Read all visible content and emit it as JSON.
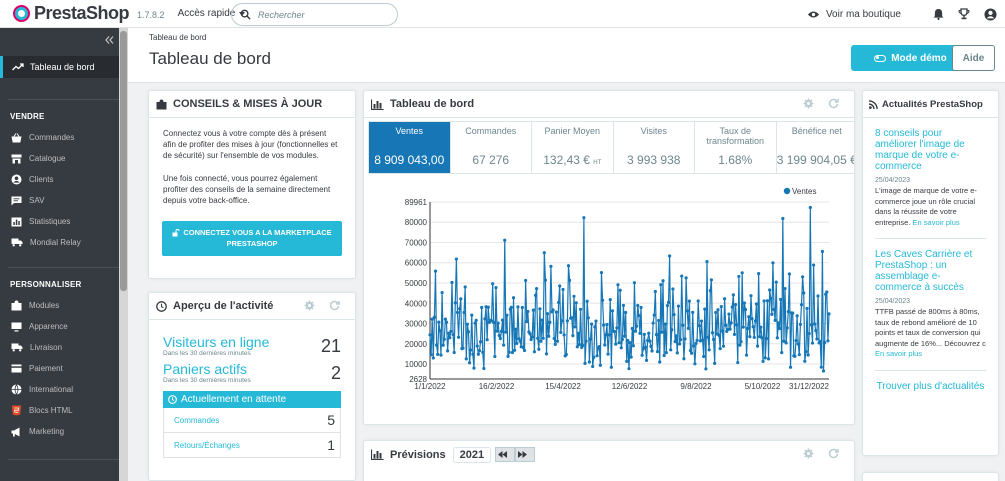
{
  "app": {
    "brand": "PrestaShop",
    "version": "1.7.8.2"
  },
  "topbar": {
    "quick_access": "Accès rapide",
    "search_placeholder": "Rechercher",
    "view_shop": "Voir ma boutique"
  },
  "sidebar": {
    "active_item": "Tableau de bord",
    "sections": [
      {
        "title": "VENDRE",
        "items": [
          "Commandes",
          "Catalogue",
          "Clients",
          "SAV",
          "Statistiques",
          "Mondial Relay"
        ]
      },
      {
        "title": "PERSONNALISER",
        "items": [
          "Modules",
          "Apparence",
          "Livraison",
          "Paiement",
          "International",
          "Blocs HTML",
          "Marketing"
        ]
      }
    ]
  },
  "header": {
    "breadcrumb": "Tableau de bord",
    "title": "Tableau de bord",
    "demo_button": "Mode démo",
    "help_button": "Aide"
  },
  "tips": {
    "title": "CONSEILS & MISES À JOUR",
    "p1": "Connectez vous à votre compte dès à présent afin de profiter des mises à jour (fonctionnelles et de sécurité) sur l'ensemble de vos modules.",
    "p2": "Une fois connecté, vous pourrez également profiter des conseils de la semaine directement depuis votre back-office.",
    "button_line1": "CONNECTEZ VOUS A LA MARKETPLACE",
    "button_line2": "PRESTASHOP"
  },
  "activity": {
    "title": "Aperçu de l'activité",
    "visitors_label": "Visiteurs en ligne",
    "visitors_sub": "Dans les 30 dernières minutes",
    "visitors_value": "21",
    "carts_label": "Paniers actifs",
    "carts_sub": "Dans les 30 dernières minutes",
    "carts_value": "2",
    "pending_title": "Actuellement en attente",
    "pending": [
      {
        "label": "Commandes",
        "value": "5"
      },
      {
        "label": "Retours/Échanges",
        "value": "1"
      }
    ]
  },
  "dashboard": {
    "title": "Tableau de bord",
    "kpis": [
      {
        "label": "Ventes",
        "value": "8 909 043,00"
      },
      {
        "label": "Commandes",
        "value": "67 276"
      },
      {
        "label": "Panier Moyen",
        "value": "132,43 €",
        "suffix": "HT"
      },
      {
        "label": "Visites",
        "value": "3 993 938"
      },
      {
        "label": "Taux de transformation",
        "value": "1.68%"
      },
      {
        "label": "Bénéfice net",
        "value": "3 199 904,05 €"
      }
    ]
  },
  "forecast": {
    "title": "Prévisions",
    "year": "2021"
  },
  "news": {
    "title": "Actualités PrestaShop",
    "items": [
      {
        "title": "8 conseils pour améliorer l'image de marque de votre e-commerce",
        "date": "25/04/2023",
        "text": "L'image de marque de votre e-commerce joue un rôle crucial dans la réussite de votre entreprise.",
        "link": "En savoir plus"
      },
      {
        "title": "Les Caves Carrière et PrestaShop : un assemblage e-commerce à succès",
        "date": "25/04/2023",
        "text": "TTFB passé de 800ms à 80ms, taux de rebond amélioré de 10 points et taux de conversion qui augmente de 16%... Découvrez c",
        "link": "En savoir plus"
      }
    ],
    "more": "Trouver plus d'actualités"
  },
  "colors": {
    "accent": "#25b9d7",
    "sidebar": "#363a41",
    "series": "#1777b6"
  },
  "chart_data": {
    "type": "line",
    "legend": [
      "Ventes"
    ],
    "legend_position": "top-right",
    "x_range": [
      "2022-01-01",
      "2022-12-31"
    ],
    "x_tick_labels": [
      "1/1/2022",
      "16/2/2022",
      "15/4/2022",
      "12/6/2022",
      "9/8/2022",
      "5/10/2022",
      "31/12/2022"
    ],
    "y_tick_labels": [
      "2628",
      "10000",
      "20000",
      "30000",
      "40000",
      "50000",
      "60000",
      "70000",
      "80000",
      "89961"
    ],
    "ylim": [
      2628,
      89961
    ],
    "grid": true,
    "series": [
      {
        "name": "Ventes",
        "values": [
          24408,
          14580,
          32197,
          13010,
          33113,
          55839,
          19314,
          14802,
          30707,
          26390,
          14434,
          45282,
          19311,
          22227,
          32195,
          30718,
          16508,
          25237,
          23009,
          26154,
          50271,
          24553,
          15700,
          40215,
          61806,
          35432,
          23212,
          37296,
          42162,
          17618,
          17838,
          35436,
          48006,
          12544,
          29638,
          25919,
          10649,
          16934,
          34150,
          14869,
          7993,
          30218,
          31567,
          18883,
          14855,
          16618,
          21003,
          37922,
          15807,
          7804,
          32281,
          38271,
          22003,
          38025,
          30624,
          31569,
          31339,
          49637,
          30429,
          13758,
          47718,
          26223,
          30215,
          24113,
          22640,
          26109,
          31694,
          19318,
          71092,
          25745,
          34116,
          13802,
          15838,
          37114,
          38005,
          15705,
          42718,
          16813,
          27207,
          20215,
          38233,
          22522,
          21319,
          18512,
          37922,
          18125,
          16720,
          51217,
          31010,
          35924,
          25838,
          24906,
          22120,
          23419,
          36624,
          16105,
          43926,
          47210,
          22703,
          17309,
          37233,
          21223,
          31705,
          22706,
          64917,
          51416,
          15023,
          34826,
          23725,
          30633,
          58204,
          35831,
          36705,
          22623,
          19724,
          35616,
          21224,
          40411,
          48521,
          25630,
          31309,
          46818,
          24417,
          14017,
          14728,
          31318,
          58524,
          51319,
          32630,
          32823,
          24016,
          43426,
          28327,
          40222,
          18516,
          25210,
          19622,
          37021,
          18224,
          19128,
          82227,
          10323,
          21320,
          41022,
          32808,
          11027,
          22326,
          29724,
          8813,
          13330,
          28328,
          31217,
          14131,
          17810,
          18625,
          9414,
          55131,
          41509,
          29231,
          19415,
          24418,
          29526,
          14931,
          24416,
          41810,
          8424,
          36222,
          26221,
          26014,
          19828,
          27824,
          49111,
          20532,
          46429,
          18020,
          22118,
          38927,
          23722,
          35432,
          11330,
          21618,
          7724,
          20512,
          13429,
          27529,
          19019,
          50128,
          26218,
          28717,
          38925,
          33931,
          25124,
          37929,
          14318,
          17428,
          24634,
          18321,
          11821,
          21631,
          25232,
          21316,
          18721,
          16433,
          30227,
          34125,
          45817,
          24520,
          16127,
          31533,
          11027,
          49122,
          25722,
          51124,
          14219,
          29735,
          15625,
          38832,
          40426,
          63318,
          17023,
          26925,
          47034,
          34420,
          21129,
          23926,
          15535,
          38620,
          19926,
          22032,
          53423,
          29129,
          12636,
          22426,
          52522,
          36231,
          27627,
          41036,
          16622,
          15331,
          35528,
          18938,
          10125,
          20226,
          21725,
          41133,
          28938,
          21423,
          31228,
          21836,
          13737,
          37125,
          7631,
          60530,
          23237,
          17027,
          46228,
          51532,
          25437,
          22125,
          10332,
          35439,
          24827,
          36828,
          24139,
          17636,
          38328,
          26340,
          18829,
          42226,
          29135,
          26132,
          27041,
          34630,
          27240,
          30331,
          38143,
          44136,
          24630,
          39340,
          29336,
          10738,
          53243,
          19341,
          21034,
          55032,
          28242,
          40144,
          36937,
          14435,
          27545,
          33339,
          23536,
          43738,
          32440,
          28446,
          23144,
          31235,
          39637,
          18841,
          54637,
          23547,
          28236,
          22945,
          11341,
          41148,
          13039,
          22643,
          41240,
          12546,
          46549,
          42342,
          34541,
          59951,
          36945,
          31542,
          50452,
          22942,
          30345,
          27548,
          41847,
          15656,
          81843,
          21247,
          47250,
          20453,
          27853,
          35844,
          54447,
          8454,
          35256,
          35155,
          14048,
          13854,
          21550,
          33757,
          19957,
          14649,
          29560,
          39258,
          53051,
          45062,
          11356,
          16159,
          37451,
          14453,
          25060,
          87261,
          29355,
          20361,
          58854,
          29763,
          26562,
          22357,
          43564,
          20458,
          21163,
          8466,
          65559,
          6564,
          20567,
          44461,
          45565,
          21468,
          34762
        ]
      }
    ]
  }
}
